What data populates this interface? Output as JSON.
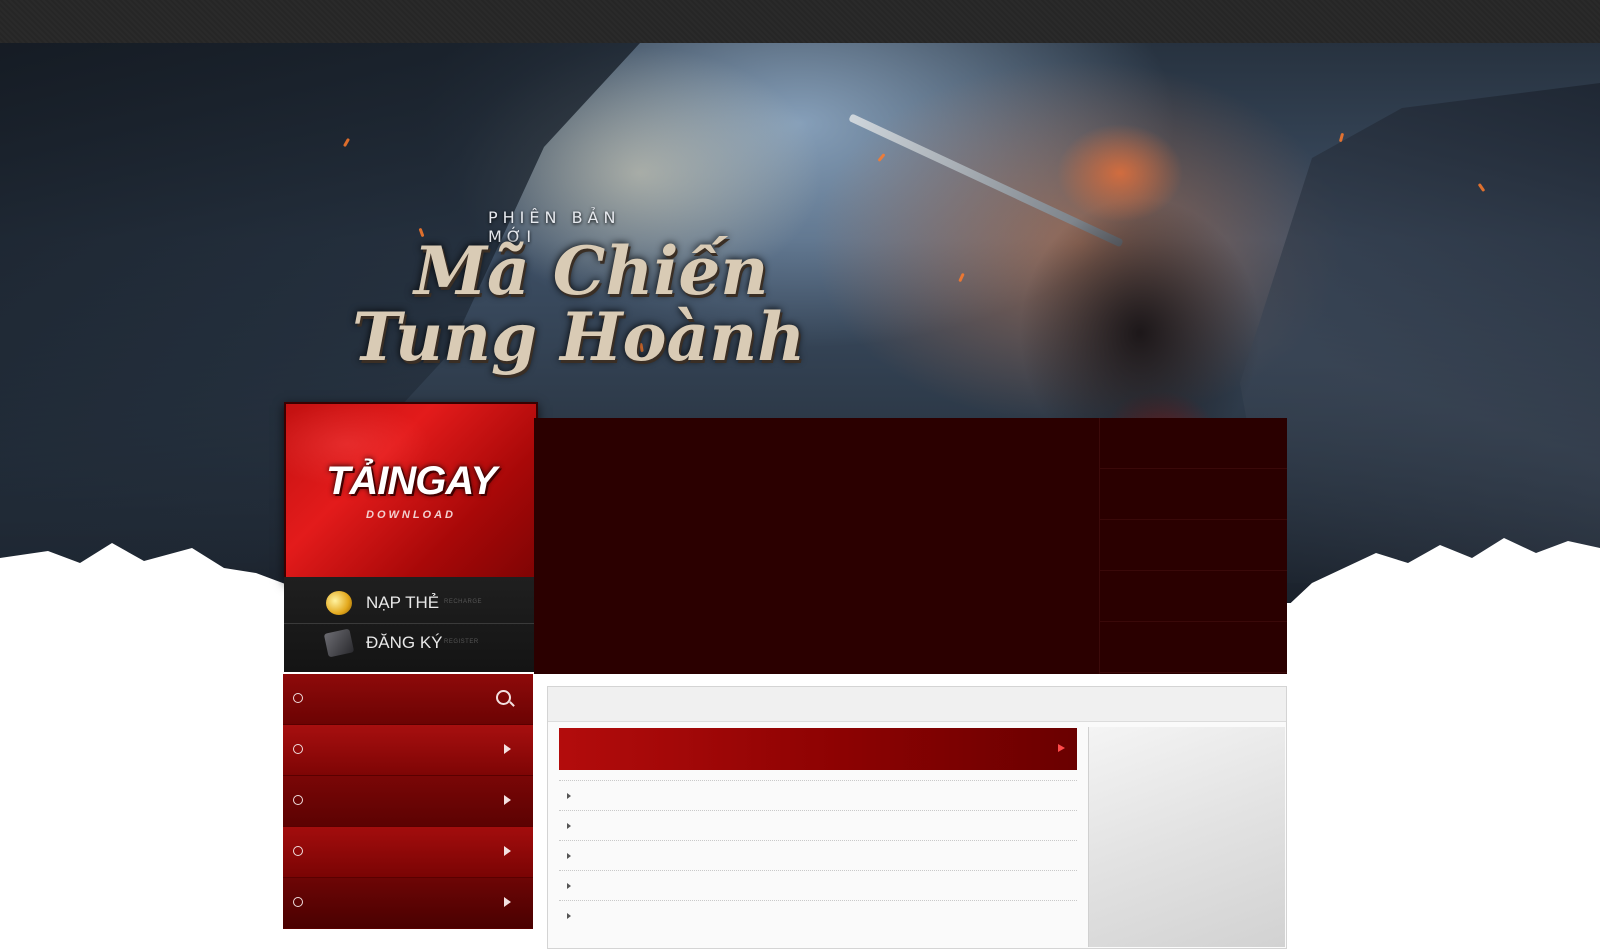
{
  "banner": {
    "subtitle": "PHIÊN BẢN MỚI",
    "title_line1": "Mã Chiến",
    "title_line2": "Tung Hoành"
  },
  "download": {
    "main_label": "TẢINGAY",
    "sub_label": "DOWNLOAD"
  },
  "quick_links": [
    {
      "label": "NẠP THẺ",
      "small": "RECHARGE",
      "icon": "gold-coins-icon"
    },
    {
      "label": "ĐĂNG KÝ",
      "small": "REGISTER",
      "icon": "book-icon"
    }
  ],
  "colors": {
    "accent_red": "#b30c0c",
    "dark_maroon": "#2b0000",
    "topbar": "#262626"
  }
}
